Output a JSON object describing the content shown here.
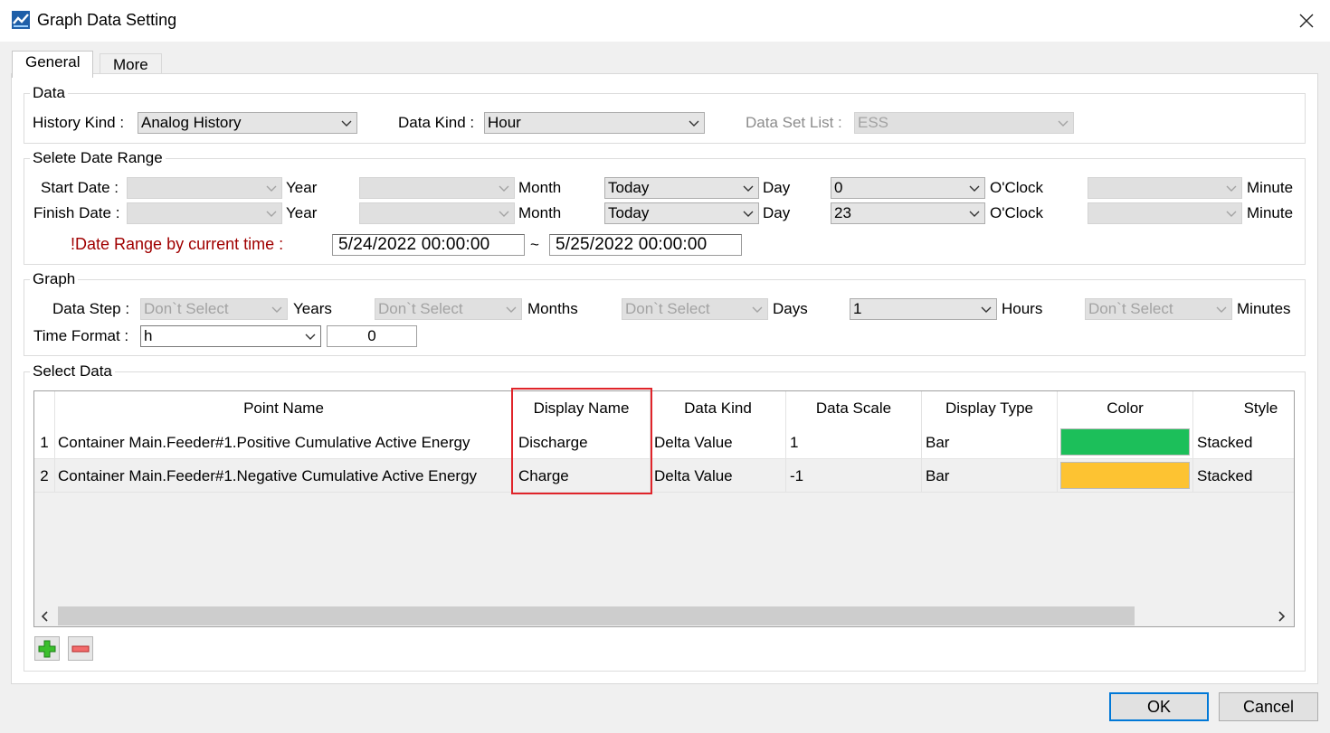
{
  "window": {
    "title": "Graph Data Setting"
  },
  "tabs": [
    {
      "label": "General"
    },
    {
      "label": "More"
    }
  ],
  "data_group": {
    "legend": "Data",
    "history_kind_label": "History Kind :",
    "history_kind_value": "Analog History",
    "data_kind_label": "Data Kind :",
    "data_kind_value": "Hour",
    "data_set_list_label": "Data Set List :",
    "data_set_list_value": "ESS"
  },
  "date_range_group": {
    "legend": "Selete Date Range",
    "start_label": "Start Date :",
    "finish_label": "Finish Date :",
    "unit_year": "Year",
    "unit_month": "Month",
    "unit_day": "Day",
    "unit_oclock": "O'Clock",
    "unit_minute": "Minute",
    "start": {
      "year": "",
      "month": "",
      "day": "Today",
      "hour": "0",
      "minute": ""
    },
    "finish": {
      "year": "",
      "month": "",
      "day": "Today",
      "hour": "23",
      "minute": ""
    },
    "range_note": "!Date Range by current time :",
    "range_start": "5/24/2022 00:00:00",
    "range_sep": "~",
    "range_end": "5/25/2022 00:00:00"
  },
  "graph_group": {
    "legend": "Graph",
    "data_step_label": "Data Step :",
    "years_value": "Don`t Select",
    "years_label": "Years",
    "months_value": "Don`t Select",
    "months_label": "Months",
    "days_value": "Don`t Select",
    "days_label": "Days",
    "hours_value": "1",
    "hours_label": "Hours",
    "minutes_value": "Don`t Select",
    "minutes_label": "Minutes",
    "time_format_label": "Time Format :",
    "time_format_value": "h",
    "time_format_offset": "0"
  },
  "select_data_group": {
    "legend": "Select Data",
    "columns": [
      "Point Name",
      "Display Name",
      "Data Kind",
      "Data Scale",
      "Display Type",
      "Color",
      "Style"
    ],
    "rows": [
      {
        "num": "1",
        "point_name": "Container Main.Feeder#1.Positive Cumulative Active Energy",
        "display_name": "Discharge",
        "data_kind": "Delta Value",
        "data_scale": "1",
        "display_type": "Bar",
        "color": "#1cbf5a",
        "style": "Stacked"
      },
      {
        "num": "2",
        "point_name": "Container Main.Feeder#1.Negative Cumulative Active Energy",
        "display_name": "Charge",
        "data_kind": "Delta Value",
        "data_scale": "-1",
        "display_type": "Bar",
        "color": "#fdc332",
        "style": "Stacked"
      }
    ]
  },
  "buttons": {
    "ok": "OK",
    "cancel": "Cancel"
  },
  "icons": {
    "app": "chart-app-icon",
    "add": "plus-icon",
    "remove": "minus-icon",
    "close": "close-icon"
  }
}
